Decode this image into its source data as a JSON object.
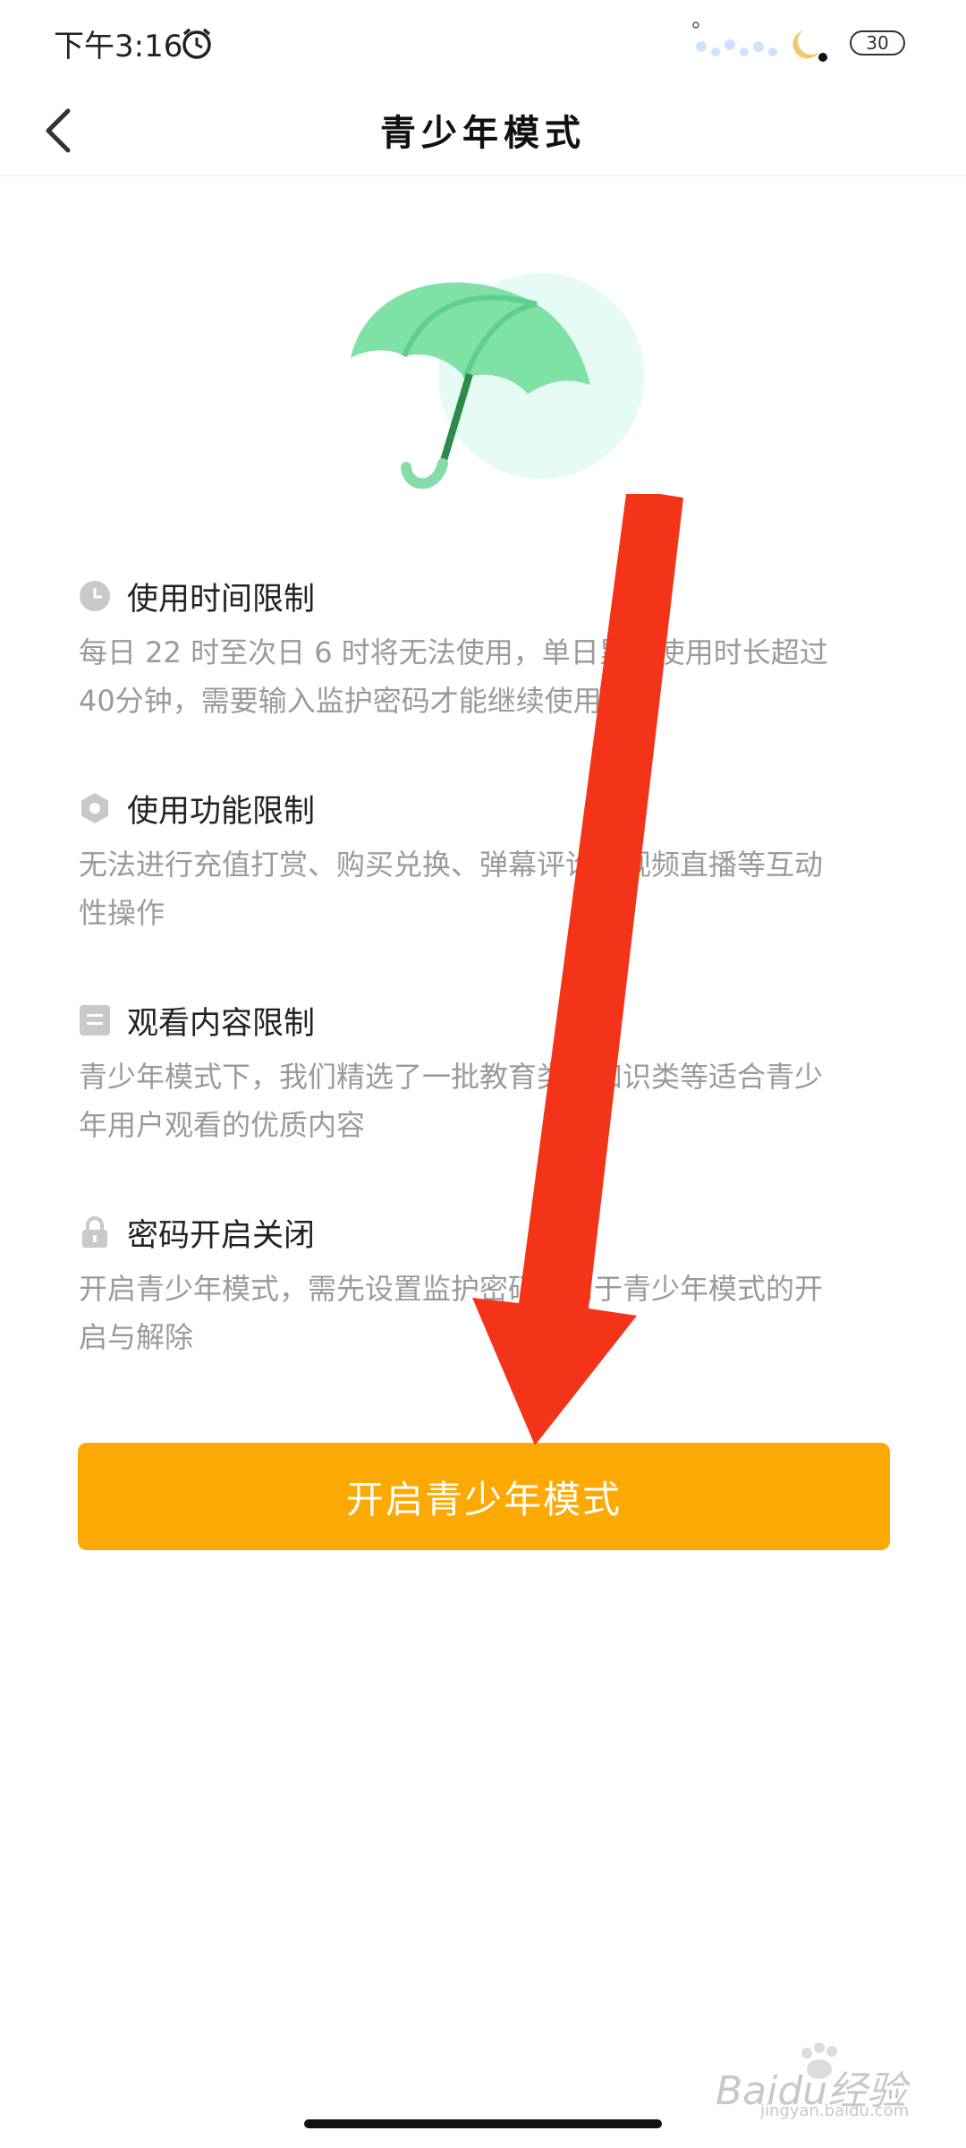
{
  "status_bar": {
    "time": "下午3:16",
    "battery": "30"
  },
  "header": {
    "title": "青少年模式"
  },
  "features": [
    {
      "icon": "clock-icon",
      "title": "使用时间限制",
      "desc_line1": "每日 22 时至次日 6 时将无法使用，单日累计使用时长超过",
      "desc_line2": "40分钟，需要输入监护密码才能继续使用"
    },
    {
      "icon": "hexagon-icon",
      "title": "使用功能限制",
      "desc_line1": "无法进行充值打赏、购买兑换、弹幕评论、视频直播等互动",
      "desc_line2": "性操作"
    },
    {
      "icon": "document-icon",
      "title": "观看内容限制",
      "desc_line1": "青少年模式下，我们精选了一批教育类、知识类等适合青少",
      "desc_line2": "年用户观看的优质内容"
    },
    {
      "icon": "lock-icon",
      "title": "密码开启关闭",
      "desc_line1": "开启青少年模式，需先设置监护密码，用于青少年模式的开",
      "desc_line2": "启与解除"
    }
  ],
  "primary_button": {
    "label": "开启青少年模式",
    "color": "#fda903"
  },
  "watermark": {
    "text": "Baidu经验",
    "sub": "jingyan.baidu.com"
  },
  "colors": {
    "annotation_arrow": "#f43418",
    "umbrella": "#7ddea0"
  }
}
